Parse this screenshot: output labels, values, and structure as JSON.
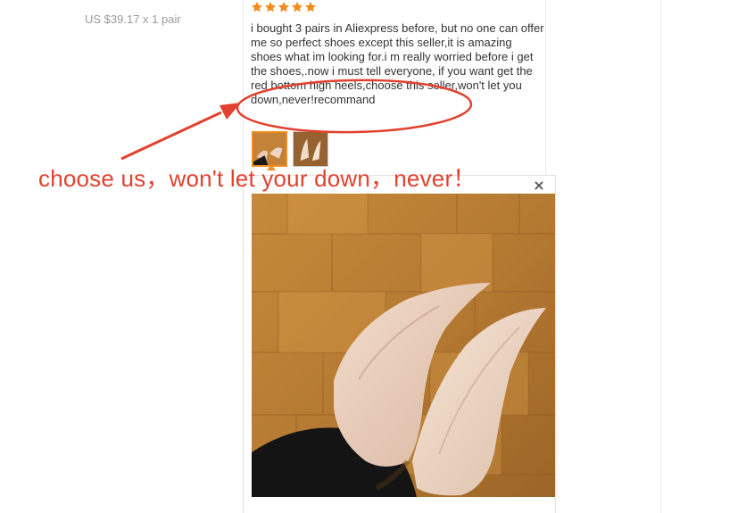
{
  "order": {
    "price_text": "US $39.17 x 1 pair"
  },
  "review": {
    "rating_stars": 5,
    "star_color": "#f08c1e",
    "text": "i bought 3 pairs in Aliexpress before, but no one can offer me so perfect shoes except this seller,it is amazing shoes what im looking for.i m really worried before i get the shoes,.now i must tell everyone, if you want get the red bottom high heels,choose this seller,won't let you down,never!recommand"
  },
  "viewer": {
    "close_glyph": "×",
    "close_icon": "close-icon"
  },
  "annotation": {
    "callout_text": "choose us，won't let your down，never！",
    "color": "#e2412f"
  }
}
